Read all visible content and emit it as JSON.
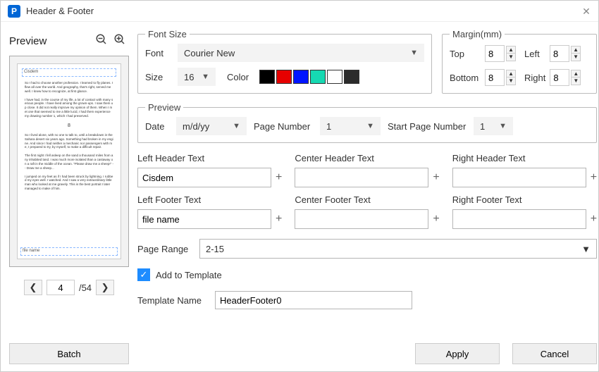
{
  "window": {
    "title": "Header & Footer"
  },
  "previewPane": {
    "label": "Preview",
    "headerSample": "Cisdem",
    "footerSample": "file name",
    "currentPage": "4",
    "totalPages": "/54"
  },
  "fontSection": {
    "legend": "Font Size",
    "fontLabel": "Font",
    "fontValue": "Courier New",
    "sizeLabel": "Size",
    "sizeValue": "16",
    "colorLabel": "Color",
    "colors": [
      "#000000",
      "#e60000",
      "#0015ff",
      "#16d9b2",
      "#ffffff",
      "#2b2b2b"
    ]
  },
  "marginSection": {
    "legend": "Margin(mm)",
    "topLabel": "Top",
    "topValue": "8",
    "leftLabel": "Left",
    "leftValue": "8",
    "bottomLabel": "Bottom",
    "bottomValue": "8",
    "rightLabel": "Right",
    "rightValue": "8"
  },
  "previewSection": {
    "legend": "Preview",
    "dateLabel": "Date",
    "dateValue": "m/d/yy",
    "pageNumLabel": "Page Number",
    "pageNumValue": "1",
    "startPageLabel": "Start Page Number",
    "startPageValue": "1"
  },
  "hf": {
    "leftHeader": {
      "label": "Left Header Text",
      "value": "Cisdem"
    },
    "centerHeader": {
      "label": "Center Header Text",
      "value": ""
    },
    "rightHeader": {
      "label": "Right Header Text",
      "value": ""
    },
    "leftFooter": {
      "label": "Left Footer Text",
      "value": "file name"
    },
    "centerFooter": {
      "label": "Center Footer Text",
      "value": ""
    },
    "rightFooter": {
      "label": "Right Footer Text",
      "value": ""
    }
  },
  "pageRange": {
    "label": "Page Range",
    "value": "2-15"
  },
  "addTemplate": {
    "label": "Add to Template",
    "checked": true
  },
  "templateName": {
    "label": "Template Name",
    "value": "HeaderFooter0"
  },
  "buttons": {
    "batch": "Batch",
    "apply": "Apply",
    "cancel": "Cancel"
  }
}
